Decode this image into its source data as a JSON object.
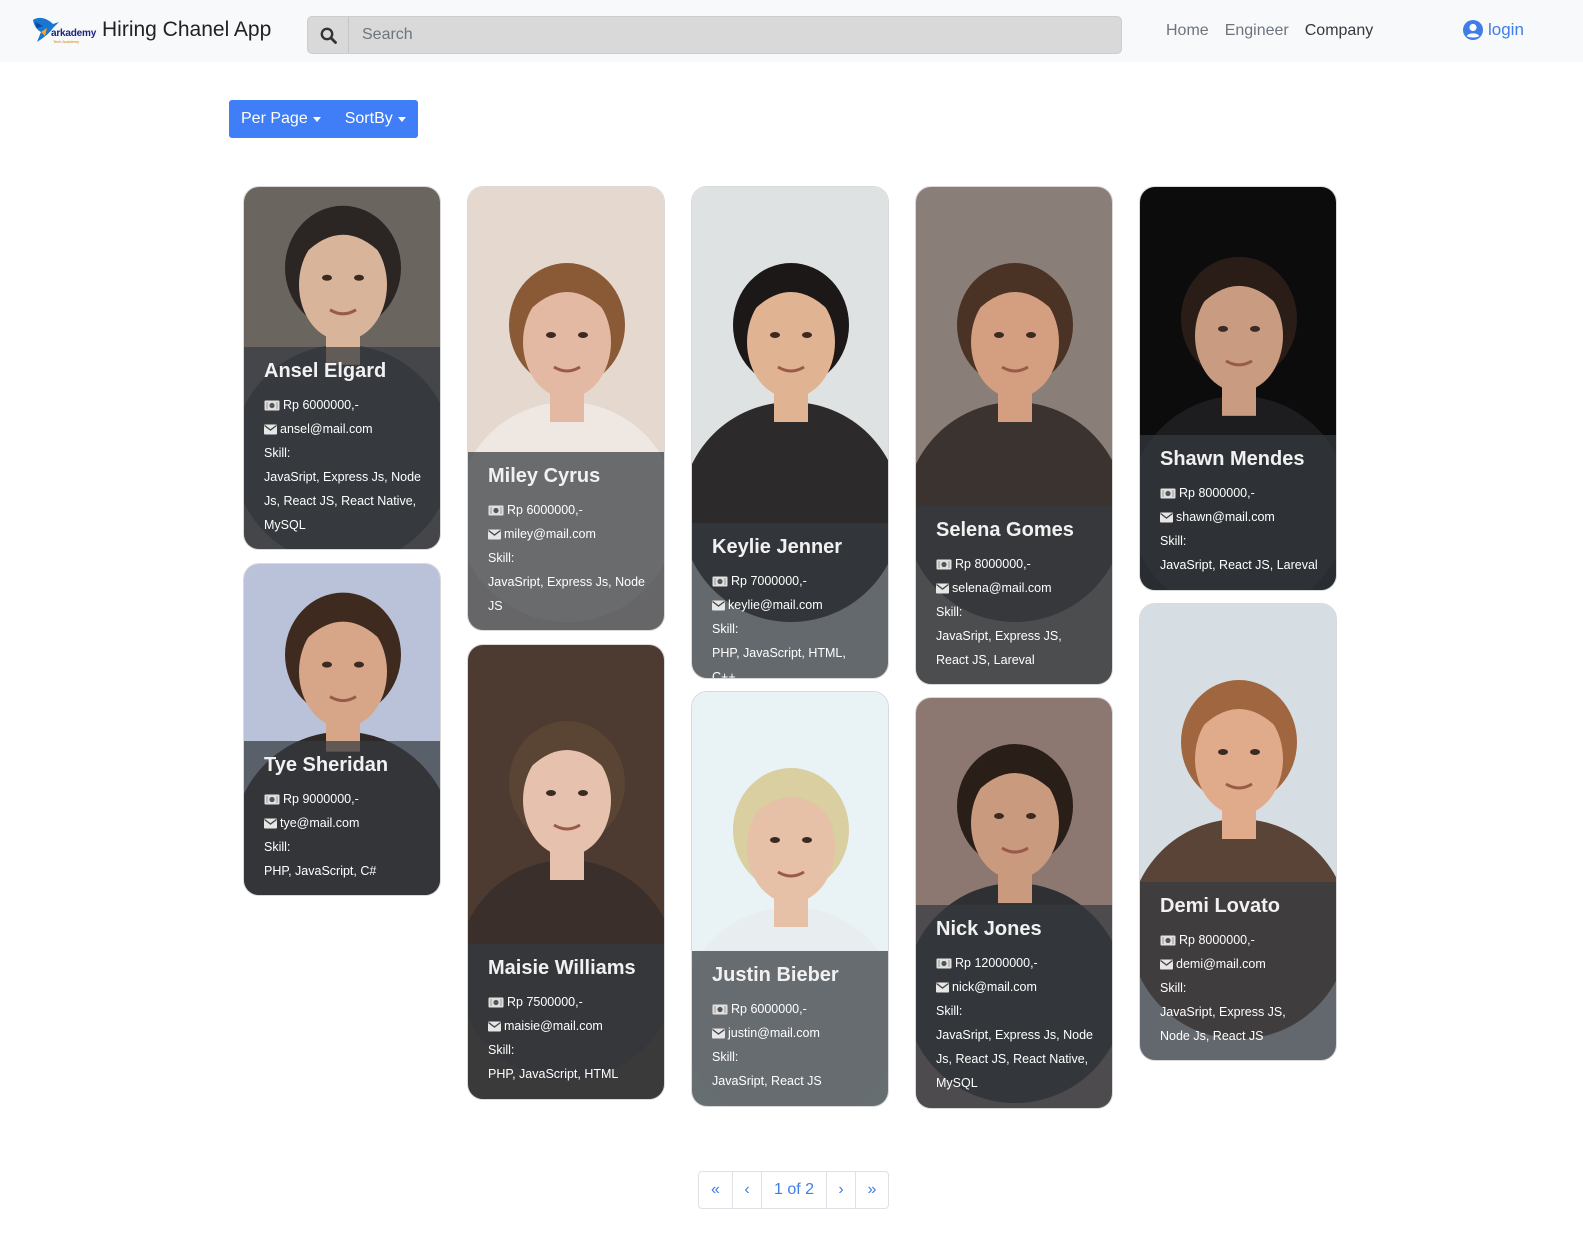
{
  "app": {
    "logo_text": "arkademy",
    "logo_sub": "Tech Academy",
    "title": "Hiring Chanel App"
  },
  "search": {
    "placeholder": "Search"
  },
  "nav": {
    "home": "Home",
    "engineer": "Engineer",
    "company": "Company",
    "login": "login"
  },
  "toolbar": {
    "per_page": "Per Page",
    "sort_by": "SortBy"
  },
  "skill_label": "Skill:",
  "engineers": [
    {
      "name": "Ansel Elgard",
      "salary": "Rp 6000000,-",
      "email": "ansel@mail.com",
      "skills": "JavaSript, Express Js, Node Js, React JS, React Native, MySQL",
      "bg": "#6b6560",
      "skin": "#d8b49a",
      "hair": "#2b2523",
      "shirt": "#3a3a3c"
    },
    {
      "name": "Tye Sheridan",
      "salary": "Rp 9000000,-",
      "email": "tye@mail.com",
      "skills": "PHP, JavaScript, C#",
      "bg": "#b9c2d8",
      "skin": "#d7a588",
      "hair": "#3e2a1e",
      "shirt": "#2f2a28"
    },
    {
      "name": "Miley Cyrus",
      "salary": "Rp 6000000,-",
      "email": "miley@mail.com",
      "skills": "JavaSript, Express Js, Node JS",
      "bg": "#e4d8cf",
      "skin": "#e3b9a3",
      "hair": "#8a5a36",
      "shirt": "#efe8e2"
    },
    {
      "name": "Maisie Williams",
      "salary": "Rp 7500000,-",
      "email": "maisie@mail.com",
      "skills": "PHP, JavaScript, HTML",
      "bg": "#4d3a30",
      "skin": "#e6c2ae",
      "hair": "#5a4535",
      "shirt": "#3a2f2b"
    },
    {
      "name": "Keylie Jenner",
      "salary": "Rp 7000000,-",
      "email": "keylie@mail.com",
      "skills": "PHP, JavaScript, HTML, C++",
      "bg": "#dfe2e2",
      "skin": "#e0b393",
      "hair": "#1b1817",
      "shirt": "#2c2a2a"
    },
    {
      "name": "Justin Bieber",
      "salary": "Rp 6000000,-",
      "email": "justin@mail.com",
      "skills": "JavaSript, React JS",
      "bg": "#e9f2f4",
      "skin": "#e6c0a7",
      "hair": "#d9cfa0",
      "shirt": "#e8eef0"
    },
    {
      "name": "Selena Gomes",
      "salary": "Rp 8000000,-",
      "email": "selena@mail.com",
      "skills": "JavaSript, Express JS, React JS, Lareval",
      "bg": "#8a7f78",
      "skin": "#d49f80",
      "hair": "#4a3324",
      "shirt": "#3b3330"
    },
    {
      "name": "Nick Jones",
      "salary": "Rp 12000000,-",
      "email": "nick@mail.com",
      "skills": "JavaSript, Express Js, Node Js, React JS, React Native, MySQL",
      "bg": "#8c7870",
      "skin": "#c99a7d",
      "hair": "#2a1e18",
      "shirt": "#2f3034"
    },
    {
      "name": "Shawn Mendes",
      "salary": "Rp 8000000,-",
      "email": "shawn@mail.com",
      "skills": "JavaSript, React JS, Lareval",
      "bg": "#0c0c0c",
      "skin": "#c99c82",
      "hair": "#2a1d17",
      "shirt": "#1d1d1f"
    },
    {
      "name": "Demi Lovato",
      "salary": "Rp 8000000,-",
      "email": "demi@mail.com",
      "skills": "JavaSript, Express JS, Node Js, React JS",
      "bg": "#d6dde3",
      "skin": "#e0ab8a",
      "hair": "#a0663f",
      "shirt": "#5a4438"
    }
  ],
  "pagination": {
    "first": "«",
    "prev": "‹",
    "current": "1 of 2",
    "next": "›",
    "last": "»"
  },
  "colors": {
    "primary": "#3f7ef7",
    "link": "#3f7ee8",
    "navbar_bg": "#f8f9fa",
    "info_overlay": "rgba(52,58,64,0.72)"
  }
}
